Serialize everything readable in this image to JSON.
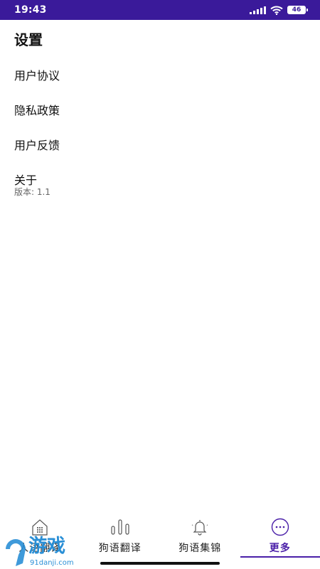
{
  "status_bar": {
    "time": "19:43",
    "battery": "46",
    "icons": [
      "signal-icon",
      "wifi-icon",
      "battery-icon"
    ]
  },
  "settings": {
    "title": "设置",
    "items": [
      {
        "label": "用户协议"
      },
      {
        "label": "隐私政策"
      },
      {
        "label": "用户反馈"
      },
      {
        "label": "关于",
        "sub": "版本: 1.1"
      }
    ]
  },
  "tabs": [
    {
      "label": "人语翻译",
      "icon": "keypad-house-icon",
      "active": false
    },
    {
      "label": "狗语翻译",
      "icon": "sound-bars-icon",
      "active": false
    },
    {
      "label": "狗语集锦",
      "icon": "bell-icon",
      "active": false
    },
    {
      "label": "更多",
      "icon": "more-dots-icon",
      "active": true
    }
  ],
  "watermark": {
    "brand": "游戏",
    "site": "91danji.com"
  },
  "colors": {
    "accent": "#4a1fa8",
    "status_bar": "#3a1a9a"
  }
}
